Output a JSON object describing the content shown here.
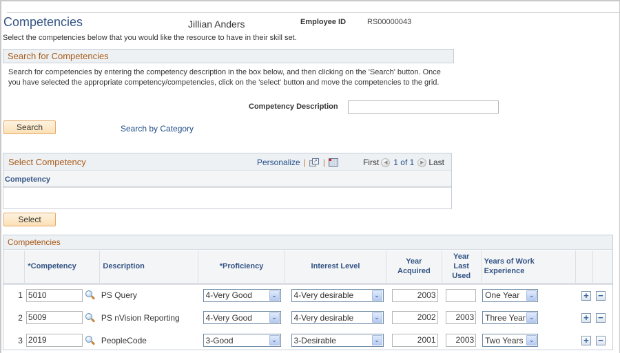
{
  "header": {
    "page_title": "Competencies",
    "employee_name": "Jillian Anders",
    "employee_id_label": "Employee ID",
    "employee_id_value": "RS00000043",
    "instructions": "Select the competencies below that you would like the resource to have in their skill set."
  },
  "search_section": {
    "title": "Search for Competencies",
    "help_text": "Search for competencies by entering the competency description in the box below, and then clicking on the 'Search' button. Once you have selected the appropriate competency/competencies, click on the 'select' button and move the competencies to the grid.",
    "description_label": "Competency Description",
    "description_value": "",
    "search_button": "Search",
    "search_by_category_link": "Search by Category"
  },
  "select_grid": {
    "title": "Select Competency",
    "personalize_link": "Personalize",
    "separator": "|",
    "nav_first": "First",
    "nav_count": "1 of 1",
    "nav_last": "Last",
    "column_header": "Competency",
    "select_button": "Select"
  },
  "competencies_grid": {
    "title": "Competencies",
    "columns": {
      "competency": "*Competency",
      "description": "Description",
      "proficiency": "*Proficiency",
      "interest_level": "Interest Level",
      "year_acquired": "Year Acquired",
      "year_last_used": "Year Last Used",
      "years_experience": "Years of Work Experience"
    },
    "rows": [
      {
        "num": "1",
        "competency": "5010",
        "description": "PS Query",
        "proficiency": "4-Very Good",
        "interest_level": "4-Very desirable",
        "year_acquired": "2003",
        "year_last_used": "",
        "years_experience": "One Year"
      },
      {
        "num": "2",
        "competency": "5009",
        "description": "PS nVision Reporting",
        "proficiency": "4-Very Good",
        "interest_level": "4-Very desirable",
        "year_acquired": "2002",
        "year_last_used": "2003",
        "years_experience": "Three Year"
      },
      {
        "num": "3",
        "competency": "2019",
        "description": "PeopleCode",
        "proficiency": "3-Good",
        "interest_level": "3-Desirable",
        "year_acquired": "2001",
        "year_last_used": "2003",
        "years_experience": "Two Years"
      }
    ],
    "add_row_symbol": "+",
    "delete_row_symbol": "−",
    "dropdown_arrow_symbol": "⌄"
  },
  "icons": {
    "lookup": "magnifying-glass-icon",
    "new_window": "new-window-icon",
    "download": "spreadsheet-icon",
    "prev": "previous-arrow-icon",
    "next": "next-arrow-icon"
  },
  "colors": {
    "title_blue": "#345484",
    "section_orange": "#a85a18",
    "link_blue": "#1e4b87",
    "button_border": "#e8a766"
  }
}
